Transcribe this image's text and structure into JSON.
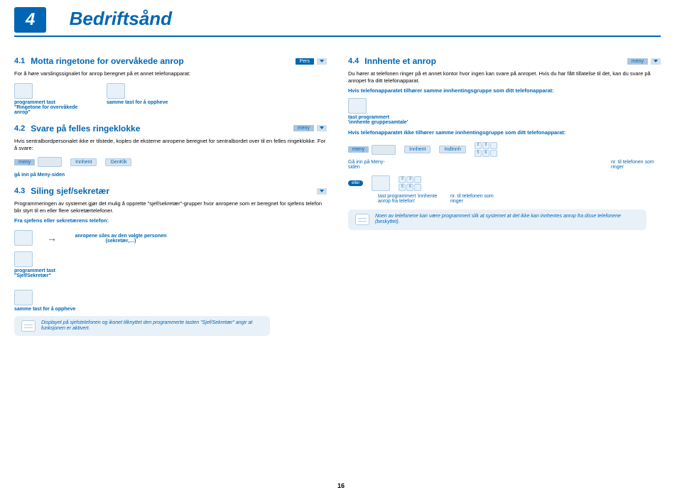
{
  "chapter": {
    "num": "4",
    "title": "Bedriftsånd"
  },
  "s41": {
    "num": "4.1",
    "title": "Motta ringetone for overvåkede anrop",
    "badge": "Pers",
    "intro": "For å høre varslingssignalet for anrop beregnet på et annet telefonapparat:",
    "k1": "programmert tast \"Ringetone for overvåkede anrop\"",
    "k2": "samme tast for å oppheve"
  },
  "s42": {
    "num": "4.2",
    "title": "Svare på felles ringeklokke",
    "badge": "meny",
    "intro": "Hvis sentralbordpersonalet ikke er tilstede, koples de eksterne anropene beregnet for sentralbordet over til en felles ringeklokke. For å svare:",
    "menybtn": "meny",
    "innhent": "Innhent",
    "genklk": "GenKlk",
    "goin": "gå inn på Meny-siden"
  },
  "s43": {
    "num": "4.3",
    "title": "Siling sjef/sekretær",
    "intro": "Programmeringen av systemet gjør det mulig å opprette \"sjef/sekretær\"-grupper hvor anropene som er beregnet for sjefens telefon blir styrt til en eller flere sekretærtelefoner.",
    "sub": "Fra sjefens eller sekretærens telefon:",
    "forward": "anropene siles av den valgte personen (sekretær,…)",
    "k1": "programmert tast \"Sjef/Sekretær\"",
    "k2": "samme tast for å oppheve",
    "callout": "Displayet på sjefstelefonen og ikonet tilknyttet den programmerte tasten \"Sjef/Sekretær\" angir at funksjonen er aktivert."
  },
  "s44": {
    "num": "4.4",
    "title": "Innhente et anrop",
    "badge": "meny",
    "intro": "Du hører at telefonen ringer på et annet kontor hvor ingen kan svare på anropet. Hvis du har fått tillatelse til det, kan du svare på anropet fra ditt telefonapparat.",
    "sub1": "Hvis telefonapparatet tilhører samme innhentingsgruppe som ditt telefonapparat:",
    "k1": "tast programmert 'innhente gruppesamtale'",
    "sub2": "Hvis telefonapparatet ikke tilhører samme innhentingsgruppe som ditt telefonapparat:",
    "menybtn": "meny",
    "innhent": "Innhent",
    "indinnh": "IndInnh",
    "goin": "Gå inn på Meny-siden",
    "numlabel": "nr. til telefonen som ringer",
    "eller": "eller",
    "k2": "tast programmert 'innhente anrop fra telefon'",
    "numlabel2": "nr. til telefonen som ringer",
    "callout": "Noen av telefonene kan være programmert slik at systemet at det ikke kan innhentes anrop fra disse telefonene (beskyttet)."
  },
  "pagenum": "16"
}
